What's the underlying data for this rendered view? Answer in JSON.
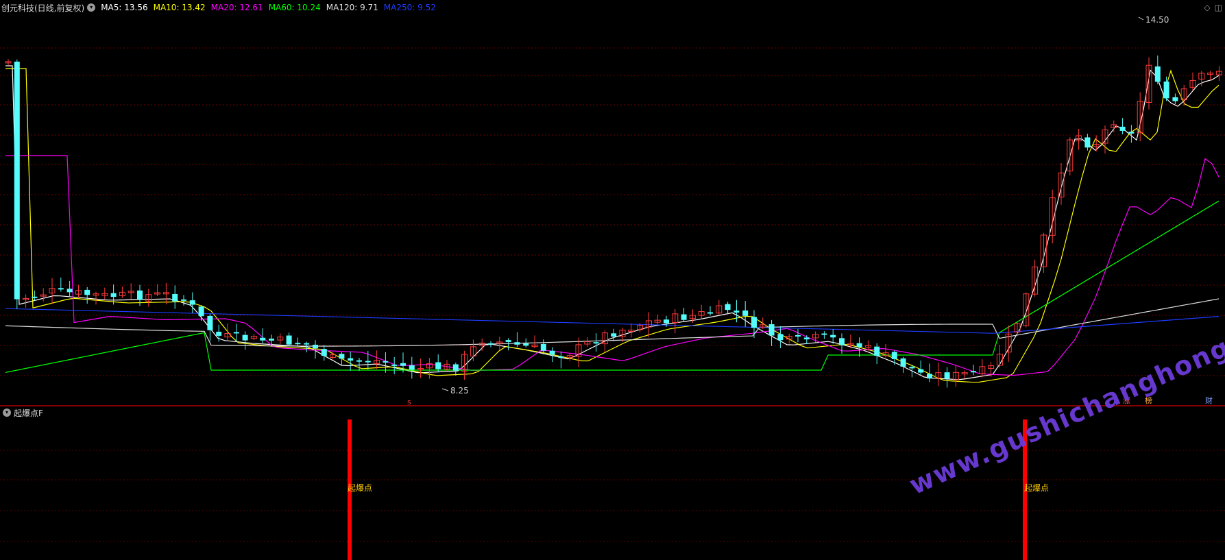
{
  "header": {
    "stock_name": "创元科技(日线,前复权)",
    "ma": [
      {
        "label": "MA5: 13.56",
        "color": "#ffffff"
      },
      {
        "label": "MA10: 13.42",
        "color": "#ffff00"
      },
      {
        "label": "MA20: 12.61",
        "color": "#ff00ff"
      },
      {
        "label": "MA60: 10.24",
        "color": "#00ff00"
      },
      {
        "label": "MA120: 9.71",
        "color": "#e0e0e0"
      },
      {
        "label": "MA250: 9.52",
        "color": "#1e3cff"
      }
    ]
  },
  "main_chart": {
    "high_label": "14.50",
    "low_label": "8.25",
    "marker_s": "s",
    "marker_zhang": "涨",
    "marker_bang": "榜",
    "marker_cai": "财",
    "colors": {
      "up": "#ff3b3b",
      "down": "#54fcfc",
      "grid": "#7a0000",
      "separator": "#b00000"
    }
  },
  "sub_chart": {
    "title": "起爆点F",
    "signal_label_1": "起爆点",
    "signal_label_2": "起爆点",
    "signal_color": "#ff0000",
    "label_color": "#ffcc00"
  },
  "watermark": "www.gushichanghong.com"
}
